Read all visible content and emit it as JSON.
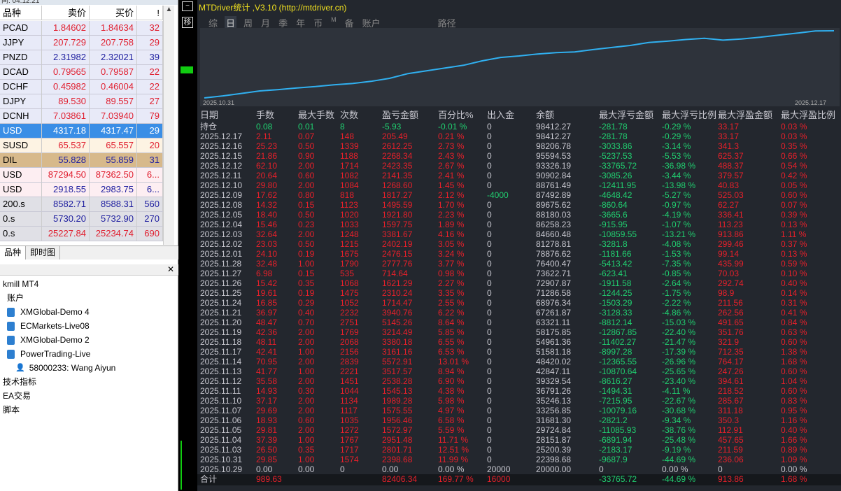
{
  "market_watch": {
    "title_fragment": "间: 04:12:21",
    "headers": [
      "品种",
      "卖价",
      "买价",
      "!"
    ],
    "rows": [
      [
        "PCAD",
        "1.84602",
        "1.84634",
        "32",
        "#e02030"
      ],
      [
        "JJPY",
        "207.729",
        "207.758",
        "29",
        "#e02030"
      ],
      [
        "PNZD",
        "2.31982",
        "2.32021",
        "39",
        "#2020a0"
      ],
      [
        "DCAD",
        "0.79565",
        "0.79587",
        "22",
        "#e02030"
      ],
      [
        "DCHF",
        "0.45982",
        "0.46004",
        "22",
        "#e02030"
      ],
      [
        "DJPY",
        "89.530",
        "89.557",
        "27",
        "#e02030"
      ],
      [
        "DCNH",
        "7.03861",
        "7.03940",
        "79",
        "#e02030"
      ],
      [
        "USD",
        "4317.18",
        "4317.47",
        "29",
        "#ffffff"
      ],
      [
        "SUSD",
        "65.537",
        "65.557",
        "20",
        "#e02030"
      ],
      [
        "DIL",
        "55.828",
        "55.859",
        "31",
        "#2020a0"
      ],
      [
        "USD",
        "87294.50",
        "87362.50",
        "6...",
        "#e02030"
      ],
      [
        "USD",
        "2918.55",
        "2983.75",
        "6...",
        "#2020a0"
      ],
      [
        "200.s",
        "8582.71",
        "8588.31",
        "560",
        "#2020a0"
      ],
      [
        "0.s",
        "5730.20",
        "5732.90",
        "270",
        "#2020a0"
      ],
      [
        "0.s",
        "25227.84",
        "25234.74",
        "690",
        "#e02030"
      ]
    ],
    "tabs": [
      "品种",
      "即时图"
    ]
  },
  "navigator": {
    "items": [
      {
        "label": "kmill MT4",
        "indent": 0,
        "icon": ""
      },
      {
        "label": "账户",
        "indent": 1,
        "icon": ""
      },
      {
        "label": "XMGlobal-Demo 4",
        "indent": 1,
        "icon": "book"
      },
      {
        "label": "ECMarkets-Live08",
        "indent": 1,
        "icon": "book"
      },
      {
        "label": "XMGlobal-Demo 2",
        "indent": 1,
        "icon": "book"
      },
      {
        "label": "PowerTrading-Live",
        "indent": 1,
        "icon": "book"
      },
      {
        "label": "58000233: Wang Aiyun",
        "indent": 3,
        "icon": "user"
      },
      {
        "label": "技术指标",
        "indent": 0,
        "icon": ""
      },
      {
        "label": "EA交易",
        "indent": 0,
        "icon": ""
      },
      {
        "label": "脚本",
        "indent": 0,
        "icon": ""
      }
    ]
  },
  "app": {
    "title": "MTDriver统计 ,V3.10 (http://mtdriver.cn)",
    "tabs": [
      "综",
      "日",
      "周",
      "月",
      "季",
      "年",
      "币",
      "M",
      "备",
      "账户",
      "路径"
    ],
    "active_tab": "日",
    "chart": {
      "start_label": "2025.10.31",
      "end_label": "2025.12.17",
      "line_color": "#30b0f0"
    },
    "headers": [
      "日期",
      "手数",
      "最大手数",
      "次数",
      "盈亏金额",
      "百分比%",
      "出入金",
      "余额",
      "最大浮亏金额",
      "最大浮亏比例",
      "最大浮盈金额",
      "最大浮盈比例"
    ],
    "rows": [
      [
        "持仓",
        "0.08",
        "0.01",
        "8",
        "-5.93",
        "-0.01 %",
        "0",
        "98412.27",
        "-281.78",
        "-0.29 %",
        "33.17",
        "0.03 %"
      ],
      [
        "2025.12.17",
        "2.11",
        "0.07",
        "148",
        "205.49",
        "0.21 %",
        "0",
        "98412.27",
        "-281.78",
        "-0.29 %",
        "33.17",
        "0.03 %"
      ],
      [
        "2025.12.16",
        "25.23",
        "0.50",
        "1339",
        "2612.25",
        "2.73 %",
        "0",
        "98206.78",
        "-3033.86",
        "-3.14 %",
        "341.3",
        "0.35 %"
      ],
      [
        "2025.12.15",
        "21.86",
        "0.90",
        "1188",
        "2268.34",
        "2.43 %",
        "0",
        "95594.53",
        "-5237.53",
        "-5.53 %",
        "625.37",
        "0.66 %"
      ],
      [
        "2025.12.12",
        "62.10",
        "2.00",
        "1714",
        "2423.35",
        "2.67 %",
        "0",
        "93326.19",
        "-33765.72",
        "-36.98 %",
        "488.37",
        "0.54 %"
      ],
      [
        "2025.12.11",
        "20.64",
        "0.60",
        "1082",
        "2141.35",
        "2.41 %",
        "0",
        "90902.84",
        "-3085.26",
        "-3.44 %",
        "379.57",
        "0.42 %"
      ],
      [
        "2025.12.10",
        "29.80",
        "2.00",
        "1084",
        "1268.60",
        "1.45 %",
        "0",
        "88761.49",
        "-12411.95",
        "-13.98 %",
        "40.83",
        "0.05 %"
      ],
      [
        "2025.12.09",
        "17.62",
        "0.80",
        "818",
        "1817.27",
        "2.12 %",
        "-4000",
        "87492.89",
        "-4648.42",
        "-5.27 %",
        "525.03",
        "0.60 %"
      ],
      [
        "2025.12.08",
        "14.32",
        "0.15",
        "1123",
        "1495.59",
        "1.70 %",
        "0",
        "89675.62",
        "-860.64",
        "-0.97 %",
        "62.27",
        "0.07 %"
      ],
      [
        "2025.12.05",
        "18.40",
        "0.50",
        "1020",
        "1921.80",
        "2.23 %",
        "0",
        "88180.03",
        "-3665.6",
        "-4.19 %",
        "336.41",
        "0.39 %"
      ],
      [
        "2025.12.04",
        "15.46",
        "0.23",
        "1033",
        "1597.75",
        "1.89 %",
        "0",
        "86258.23",
        "-915.95",
        "-1.07 %",
        "113.23",
        "0.13 %"
      ],
      [
        "2025.12.03",
        "32.64",
        "2.00",
        "1248",
        "3381.67",
        "4.16 %",
        "0",
        "84660.48",
        "-10859.55",
        "-13.21 %",
        "913.86",
        "1.11 %"
      ],
      [
        "2025.12.02",
        "23.03",
        "0.50",
        "1215",
        "2402.19",
        "3.05 %",
        "0",
        "81278.81",
        "-3281.8",
        "-4.08 %",
        "299.46",
        "0.37 %"
      ],
      [
        "2025.12.01",
        "24.10",
        "0.19",
        "1675",
        "2476.15",
        "3.24 %",
        "0",
        "78876.62",
        "-1181.66",
        "-1.53 %",
        "99.14",
        "0.13 %"
      ],
      [
        "2025.11.28",
        "32.48",
        "1.00",
        "1790",
        "2777.76",
        "3.77 %",
        "0",
        "76400.47",
        "-5413.42",
        "-7.35 %",
        "435.99",
        "0.59 %"
      ],
      [
        "2025.11.27",
        "6.98",
        "0.15",
        "535",
        "714.64",
        "0.98 %",
        "0",
        "73622.71",
        "-623.41",
        "-0.85 %",
        "70.03",
        "0.10 %"
      ],
      [
        "2025.11.26",
        "15.42",
        "0.35",
        "1068",
        "1621.29",
        "2.27 %",
        "0",
        "72907.87",
        "-1911.58",
        "-2.64 %",
        "292.74",
        "0.40 %"
      ],
      [
        "2025.11.25",
        "19.61",
        "0.19",
        "1475",
        "2310.24",
        "3.35 %",
        "0",
        "71286.58",
        "-1244.25",
        "-1.75 %",
        "98.9",
        "0.14 %"
      ],
      [
        "2025.11.24",
        "16.85",
        "0.29",
        "1052",
        "1714.47",
        "2.55 %",
        "0",
        "68976.34",
        "-1503.29",
        "-2.22 %",
        "211.56",
        "0.31 %"
      ],
      [
        "2025.11.21",
        "36.97",
        "0.40",
        "2232",
        "3940.76",
        "6.22 %",
        "0",
        "67261.87",
        "-3128.33",
        "-4.86 %",
        "262.56",
        "0.41 %"
      ],
      [
        "2025.11.20",
        "48.47",
        "0.70",
        "2751",
        "5145.26",
        "8.64 %",
        "0",
        "63321.11",
        "-8812.14",
        "-15.03 %",
        "491.65",
        "0.84 %"
      ],
      [
        "2025.11.19",
        "42.36",
        "2.00",
        "1769",
        "3214.49",
        "5.85 %",
        "0",
        "58175.85",
        "-12867.85",
        "-22.40 %",
        "351.76",
        "0.63 %"
      ],
      [
        "2025.11.18",
        "48.11",
        "2.00",
        "2068",
        "3380.18",
        "6.55 %",
        "0",
        "54961.36",
        "-11402.27",
        "-21.47 %",
        "321.9",
        "0.60 %"
      ],
      [
        "2025.11.17",
        "42.41",
        "1.00",
        "2156",
        "3161.16",
        "6.53 %",
        "0",
        "51581.18",
        "-8997.28",
        "-17.39 %",
        "712.35",
        "1.38 %"
      ],
      [
        "2025.11.14",
        "70.95",
        "2.00",
        "2839",
        "5572.91",
        "13.01 %",
        "0",
        "48420.02",
        "-12365.55",
        "-26.96 %",
        "764.17",
        "1.68 %"
      ],
      [
        "2025.11.13",
        "41.77",
        "1.00",
        "2221",
        "3517.57",
        "8.94 %",
        "0",
        "42847.11",
        "-10870.64",
        "-25.65 %",
        "247.26",
        "0.60 %"
      ],
      [
        "2025.11.12",
        "35.58",
        "2.00",
        "1451",
        "2538.28",
        "6.90 %",
        "0",
        "39329.54",
        "-8616.27",
        "-23.40 %",
        "394.61",
        "1.04 %"
      ],
      [
        "2025.11.11",
        "14.93",
        "0.30",
        "1044",
        "1545.13",
        "4.38 %",
        "0",
        "36791.26",
        "-1494.31",
        "-4.11 %",
        "218.52",
        "0.60 %"
      ],
      [
        "2025.11.10",
        "37.17",
        "2.00",
        "1134",
        "1989.28",
        "5.98 %",
        "0",
        "35246.13",
        "-7215.95",
        "-22.67 %",
        "285.67",
        "0.83 %"
      ],
      [
        "2025.11.07",
        "29.69",
        "2.00",
        "1117",
        "1575.55",
        "4.97 %",
        "0",
        "33256.85",
        "-10079.16",
        "-30.68 %",
        "311.18",
        "0.95 %"
      ],
      [
        "2025.11.06",
        "18.93",
        "0.60",
        "1035",
        "1956.46",
        "6.58 %",
        "0",
        "31681.30",
        "-2821.2",
        "-9.34 %",
        "350.3",
        "1.16 %"
      ],
      [
        "2025.11.05",
        "29.81",
        "2.00",
        "1272",
        "1572.97",
        "5.59 %",
        "0",
        "29724.84",
        "-11085.93",
        "-38.76 %",
        "112.91",
        "0.40 %"
      ],
      [
        "2025.11.04",
        "37.39",
        "1.00",
        "1767",
        "2951.48",
        "11.71 %",
        "0",
        "28151.87",
        "-6891.94",
        "-25.48 %",
        "457.65",
        "1.66 %"
      ],
      [
        "2025.11.03",
        "26.50",
        "0.35",
        "1717",
        "2801.71",
        "12.51 %",
        "0",
        "25200.39",
        "-2183.17",
        "-9.19 %",
        "211.59",
        "0.89 %"
      ],
      [
        "2025.10.31",
        "29.85",
        "1.00",
        "1574",
        "2398.68",
        "11.99 %",
        "0",
        "22398.68",
        "-9687.9",
        "-44.69 %",
        "236.06",
        "1.09 %"
      ],
      [
        "2025.10.29",
        "0.00",
        "0.00",
        "0",
        "0.00",
        "0.00 %",
        "20000",
        "20000.00",
        "0",
        "0.00 %",
        "0",
        "0.00 %"
      ]
    ],
    "total": [
      "合计",
      "989.63",
      "",
      "",
      "82406.34",
      "169.77 %",
      "16000",
      "",
      "-33765.72",
      "-44.69 %",
      "913.86",
      "1.68 %"
    ]
  }
}
